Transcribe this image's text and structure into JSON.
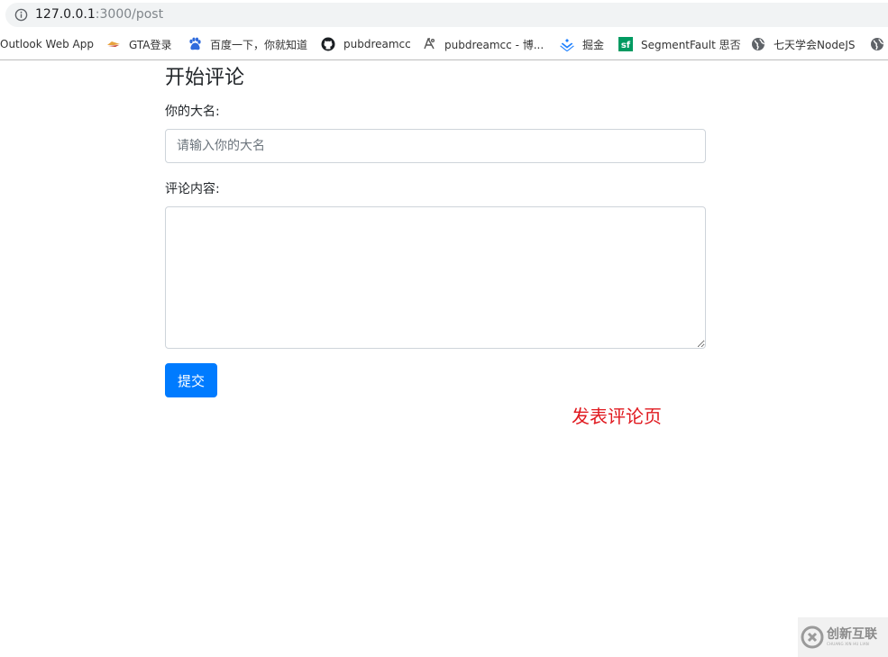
{
  "browser": {
    "url_host": "127.0.0.1",
    "url_path": ":3000/post",
    "bookmarks": [
      {
        "label": "Outlook Web App",
        "icon": "none"
      },
      {
        "label": "GTA登录",
        "icon": "gta-icon"
      },
      {
        "label": "百度一下，你就知道",
        "icon": "baidu-paw-icon"
      },
      {
        "label": "pubdreamcc",
        "icon": "github-icon"
      },
      {
        "label": "pubdreamcc - 博...",
        "icon": "blog-icon"
      },
      {
        "label": "掘金",
        "icon": "juejin-icon"
      },
      {
        "label": "SegmentFault 思否",
        "icon": "segmentfault-icon"
      },
      {
        "label": "七天学会NodeJS",
        "icon": "globe-icon"
      }
    ]
  },
  "form": {
    "title": "开始评论",
    "name_label": "你的大名:",
    "name_placeholder": "请输入你的大名",
    "name_value": "",
    "content_label": "评论内容:",
    "content_value": "",
    "submit_label": "提交"
  },
  "annotation": "发表评论页",
  "watermark": {
    "text": "创新互联",
    "subtext": "CHUANG XIN HU LIAN"
  },
  "colors": {
    "primary": "#007bff",
    "annotation": "#e0191f"
  }
}
